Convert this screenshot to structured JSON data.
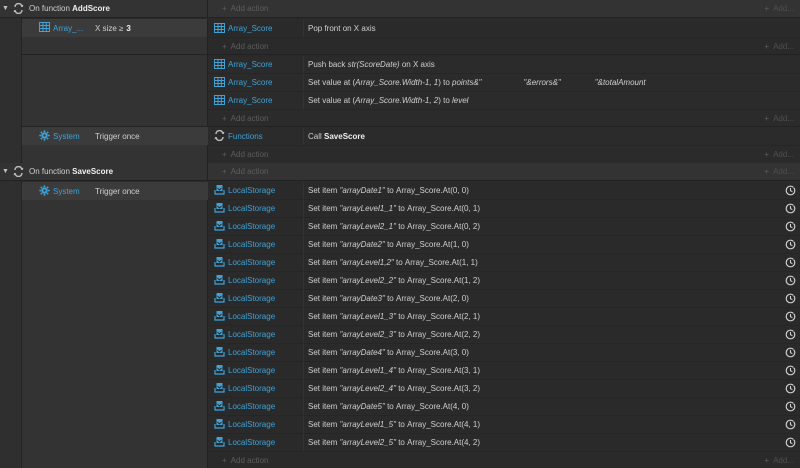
{
  "add_action_label": "Add action",
  "add_more_label": "Add...",
  "functions": [
    {
      "prefix": "On function",
      "name": "AddScore"
    },
    {
      "prefix": "On function",
      "name": "SaveScore"
    }
  ],
  "addscore": {
    "cond1": {
      "object": "Array_...",
      "text": "X size ≥",
      "value": "3"
    },
    "act1": {
      "object": "Array_Score",
      "text": "Pop front on X axis"
    },
    "act2": {
      "object": "Array_Score",
      "pre": "Push back ",
      "italic": "str(ScoreDate)",
      "post": " on X axis"
    },
    "act3": {
      "object": "Array_Score",
      "pre": "Set value at (",
      "italic": "Array_Score.Width-1, 1",
      "mid": ") to ",
      "i2": "points&\"",
      "i3": "\"&errors&\"",
      "i4": "\"&totalAmount"
    },
    "act4": {
      "object": "Array_Score",
      "pre": "Set value at (",
      "italic": "Array_Score.Width-1, 2",
      "mid": ") to ",
      "i2": "level"
    },
    "cond2": {
      "object": "System",
      "text": "Trigger once"
    },
    "act5": {
      "object": "Functions",
      "pre": "Call ",
      "bold": "SaveScore"
    }
  },
  "savescore": {
    "cond": {
      "object": "System",
      "text": "Trigger once"
    },
    "object": "LocalStorage",
    "items": [
      {
        "key": "\"arrayDate1\"",
        "to": "Array_Score.At(0, 0)"
      },
      {
        "key": "\"arrayLevel1_1\"",
        "to": "Array_Score.At(0, 1)"
      },
      {
        "key": "\"arrayLevel2_1\"",
        "to": "Array_Score.At(0, 2)"
      },
      {
        "key": "\"arrayDate2\"",
        "to": "Array_Score.At(1, 0)"
      },
      {
        "key": "\"arrayLevel1,2\"",
        "to": "Array_Score.At(1, 1)"
      },
      {
        "key": "\"arrayLevel2_2\"",
        "to": "Array_Score.At(1, 2)"
      },
      {
        "key": "\"arrayDate3\"",
        "to": "Array_Score.At(2, 0)"
      },
      {
        "key": "\"arrayLevel1_3\"",
        "to": "Array_Score.At(2, 1)"
      },
      {
        "key": "\"arrayLevel2_3\"",
        "to": "Array_Score.At(2, 2)"
      },
      {
        "key": "\"arrayDate4\"",
        "to": "Array_Score.At(3, 0)"
      },
      {
        "key": "\"arrayLevel1_4\"",
        "to": "Array_Score.At(3, 1)"
      },
      {
        "key": "\"arrayLevel2_4\"",
        "to": "Array_Score.At(3, 2)"
      },
      {
        "key": "\"arrayDate5\"",
        "to": "Array_Score.At(4, 0)"
      },
      {
        "key": "\"arrayLevel1_5\"",
        "to": "Array_Score.At(4, 1)"
      },
      {
        "key": "\"arrayLevel2_5\"",
        "to": "Array_Score.At(4, 2)"
      }
    ],
    "set_item_label": "Set item",
    "to_label": "to"
  },
  "icons": {
    "collapse": "triangle-down",
    "function": "function-arrows-icon",
    "array": "array-grid-icon",
    "system": "gear-icon",
    "localstorage": "storage-icon",
    "clock": "async-clock-icon"
  },
  "colors": {
    "object_text": "#3fa3d8",
    "background": "#2b2b2b"
  }
}
